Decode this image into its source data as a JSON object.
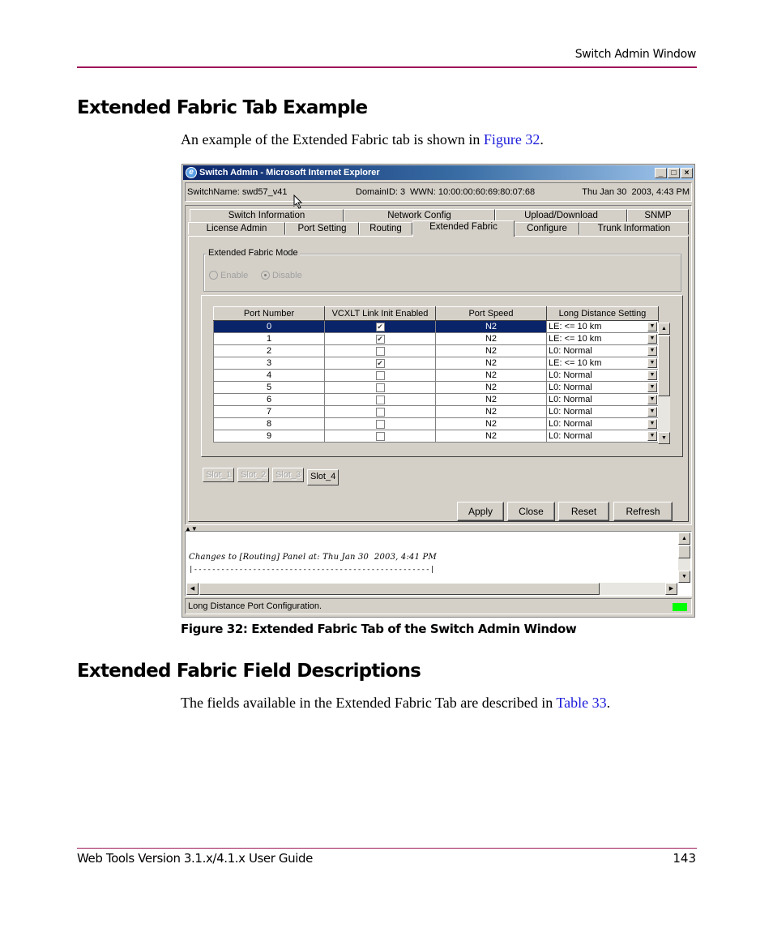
{
  "page_header": {
    "section": "Switch Admin Window"
  },
  "section1": {
    "heading": "Extended Fabric Tab Example",
    "para_pre": "An example of the Extended Fabric tab is shown in ",
    "para_link": "Figure 32",
    "para_post": "."
  },
  "window": {
    "title": "Switch Admin - Microsoft Internet Explorer",
    "controls": {
      "minimize": "_",
      "maximize": "□",
      "close": "×"
    },
    "info": {
      "switch_name": "SwitchName: swd57_v41",
      "domain": "DomainID: 3",
      "wwn": "WWN: 10:00:00:60:69:80:07:68",
      "datetime": "Thu Jan 30  2003, 4:43 PM"
    },
    "tabs_row1": [
      "Switch Information",
      "Network Config",
      "Upload/Download",
      "SNMP"
    ],
    "tabs_row2": [
      "License Admin",
      "Port Setting",
      "Routing",
      "Extended Fabric",
      "Configure",
      "Trunk Information"
    ],
    "active_tab": "Extended Fabric",
    "mode": {
      "legend": "Extended Fabric Mode",
      "options": [
        "Enable",
        "Disable"
      ],
      "selected": "Disable"
    },
    "table": {
      "columns": [
        "Port Number",
        "VCXLT Link Init Enabled",
        "Port Speed",
        "Long Distance Setting"
      ],
      "rows": [
        {
          "port": "0",
          "vcxlt": true,
          "speed": "N2",
          "ld": "LE: <= 10 km"
        },
        {
          "port": "1",
          "vcxlt": true,
          "speed": "N2",
          "ld": "LE: <= 10 km"
        },
        {
          "port": "2",
          "vcxlt": false,
          "speed": "N2",
          "ld": "L0: Normal"
        },
        {
          "port": "3",
          "vcxlt": true,
          "speed": "N2",
          "ld": "LE: <= 10 km"
        },
        {
          "port": "4",
          "vcxlt": false,
          "speed": "N2",
          "ld": "L0: Normal"
        },
        {
          "port": "5",
          "vcxlt": false,
          "speed": "N2",
          "ld": "L0: Normal"
        },
        {
          "port": "6",
          "vcxlt": false,
          "speed": "N2",
          "ld": "L0: Normal"
        },
        {
          "port": "7",
          "vcxlt": false,
          "speed": "N2",
          "ld": "L0: Normal"
        },
        {
          "port": "8",
          "vcxlt": false,
          "speed": "N2",
          "ld": "L0: Normal"
        },
        {
          "port": "9",
          "vcxlt": false,
          "speed": "N2",
          "ld": "L0: Normal"
        }
      ],
      "selected_row": 0
    },
    "slots": [
      "Slot_1",
      "Slot_2",
      "Slot_3",
      "Slot_4"
    ],
    "active_slot": "Slot_4",
    "buttons": {
      "apply": "Apply",
      "close": "Close",
      "reset": "Reset",
      "refresh": "Refresh"
    },
    "log": {
      "line1": "Changes to [Routing] Panel at: Thu Jan 30  2003, 4:41 PM",
      "line2": "|----------------------------------------------------|"
    },
    "status": {
      "text": "Long Distance Port Configuration.",
      "indicator_color": "#00ff00"
    }
  },
  "caption": "Figure 32:  Extended Fabric Tab of the Switch Admin Window",
  "section2": {
    "heading": "Extended Fabric Field Descriptions",
    "para_pre": "The fields available in the Extended Fabric Tab are described in ",
    "para_link": "Table 33",
    "para_post": "."
  },
  "footer": {
    "title": "Web Tools Version 3.1.x/4.1.x User Guide",
    "page": "143"
  },
  "colors": {
    "rule": "#a0155a",
    "link": "#1a1adb",
    "selection": "#0a246a"
  }
}
